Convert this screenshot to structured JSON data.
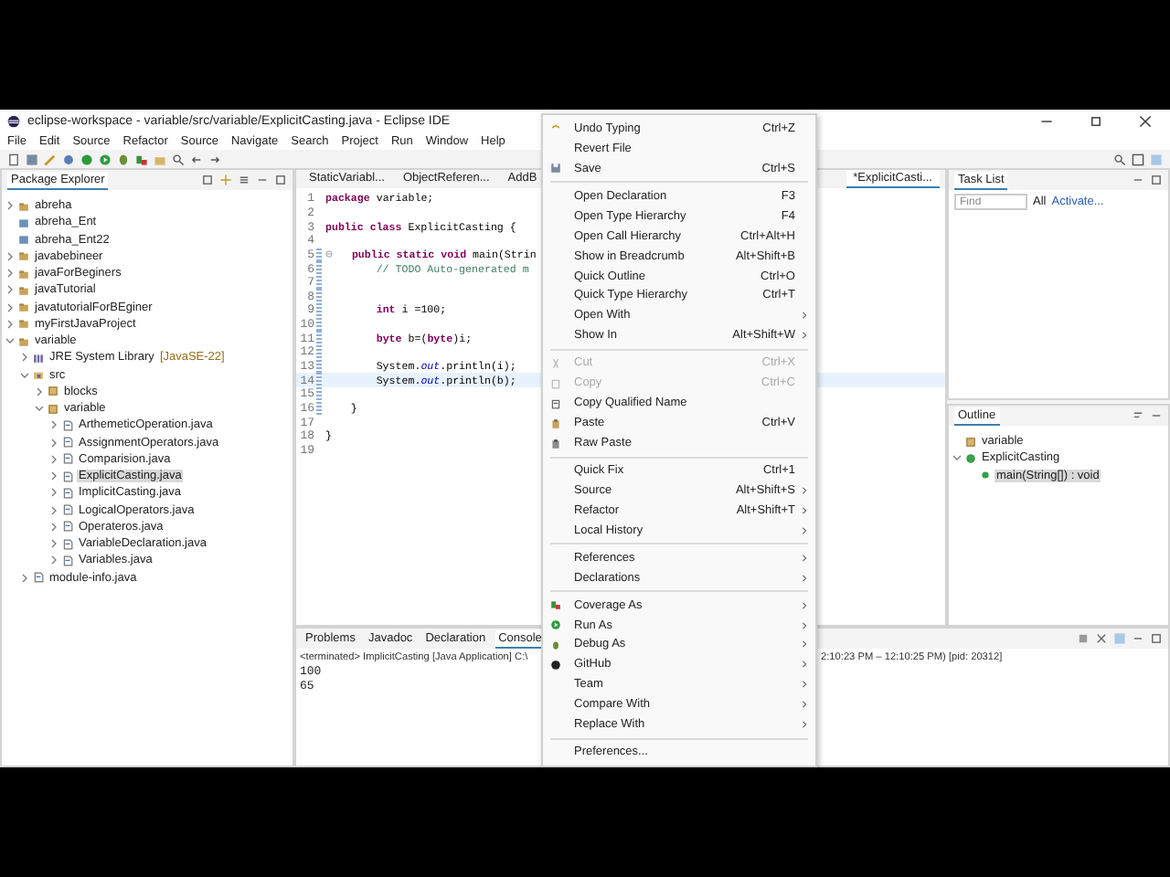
{
  "window": {
    "title": "eclipse-workspace - variable/src/variable/ExplicitCasting.java - Eclipse IDE"
  },
  "menu_bar": [
    "File",
    "Edit",
    "Source",
    "Refactor",
    "Source",
    "Navigate",
    "Search",
    "Project",
    "Run",
    "Window",
    "Help"
  ],
  "package_explorer": {
    "title": "Package Explorer",
    "tree": [
      {
        "label": "abreha",
        "kind": "project",
        "expanded": false,
        "selected": false
      },
      {
        "label": "abreha_Ent",
        "kind": "closed-project",
        "selected": false
      },
      {
        "label": "abreha_Ent22",
        "kind": "closed-project",
        "selected": false
      },
      {
        "label": "javabebineer",
        "kind": "project",
        "expanded": false,
        "selected": false
      },
      {
        "label": "javaForBeginers",
        "kind": "project",
        "expanded": false,
        "selected": false
      },
      {
        "label": "javaTutorial",
        "kind": "project",
        "expanded": false,
        "selected": false
      },
      {
        "label": "javatutorialForBEginer",
        "kind": "project",
        "expanded": false,
        "selected": false
      },
      {
        "label": "myFirstJavaProject",
        "kind": "project",
        "expanded": false,
        "selected": false
      },
      {
        "label": "variable",
        "kind": "project",
        "expanded": true,
        "selected": false,
        "children": [
          {
            "label": "JRE System Library",
            "decoration": "[JavaSE-22]",
            "kind": "library",
            "expanded": false,
            "selected": false
          },
          {
            "label": "src",
            "kind": "folder",
            "expanded": true,
            "selected": false,
            "children": [
              {
                "label": "blocks",
                "kind": "package",
                "expanded": false,
                "selected": false
              },
              {
                "label": "variable",
                "kind": "package",
                "expanded": true,
                "selected": false,
                "children": [
                  {
                    "label": "ArthemeticOperation.java",
                    "kind": "file",
                    "expanded": false,
                    "selected": false
                  },
                  {
                    "label": "AssignmentOperators.java",
                    "kind": "file",
                    "expanded": false,
                    "selected": false
                  },
                  {
                    "label": "Comparision.java",
                    "kind": "file",
                    "expanded": false,
                    "selected": false
                  },
                  {
                    "label": "ExplicitCasting.java",
                    "kind": "file",
                    "expanded": false,
                    "selected": true
                  },
                  {
                    "label": "ImplicitCasting.java",
                    "kind": "file",
                    "expanded": false,
                    "selected": false
                  },
                  {
                    "label": "LogicalOperators.java",
                    "kind": "file",
                    "expanded": false,
                    "selected": false
                  },
                  {
                    "label": "Operateros.java",
                    "kind": "file",
                    "expanded": false,
                    "selected": false
                  },
                  {
                    "label": "VariableDeclaration.java",
                    "kind": "file",
                    "expanded": false,
                    "selected": false
                  },
                  {
                    "label": "Variables.java",
                    "kind": "file",
                    "expanded": false,
                    "selected": false
                  }
                ]
              }
            ]
          },
          {
            "label": "module-info.java",
            "kind": "file",
            "expanded": false,
            "selected": false
          }
        ]
      }
    ]
  },
  "editor": {
    "tabs": [
      {
        "label": "StaticVariabl...",
        "selected": false
      },
      {
        "label": "ObjectReferen...",
        "selected": false
      },
      {
        "label": "AddB",
        "selected": false
      },
      {
        "label": "*ExplicitCasti...",
        "selected": true
      }
    ],
    "lines": [
      {
        "number": "1",
        "code": "**package** variable;",
        "kind": "code",
        "current": false
      },
      {
        "number": "2",
        "current": false
      },
      {
        "number": "3",
        "code": "**public class** ExplicitCasting {",
        "kind": "code",
        "current": false
      },
      {
        "number": "4",
        "current": false
      },
      {
        "number": "5",
        "code": "   **public static void** main(Strin",
        "kind": "code",
        "current": false,
        "folded": false
      },
      {
        "number": "6",
        "code": "        // TODO Auto-generated m",
        "kind": "comment",
        "current": false
      },
      {
        "number": "7",
        "current": false
      },
      {
        "number": "8",
        "current": false
      },
      {
        "number": "9",
        "code": "        **int** i =100;",
        "kind": "code",
        "current": false
      },
      {
        "number": "10",
        "current": false
      },
      {
        "number": "11",
        "code": "        **byte** b=(**byte**)i;",
        "kind": "code",
        "current": false
      },
      {
        "number": "12",
        "current": false
      },
      {
        "number": "13",
        "code": "        System.*out*.println(i);",
        "kind": "code",
        "current": false
      },
      {
        "number": "14",
        "code": "        System.*out*.println(b);",
        "kind": "code",
        "current": true
      },
      {
        "number": "15",
        "current": false
      },
      {
        "number": "16",
        "code": "    }",
        "kind": "code",
        "current": false
      },
      {
        "number": "17",
        "current": false
      },
      {
        "number": "18",
        "code": "}",
        "kind": "code",
        "current": false
      },
      {
        "number": "19",
        "current": false
      }
    ]
  },
  "task_list": {
    "title": "Task List",
    "find": {
      "placeholder": "Find"
    },
    "filters": [
      "All",
      "Activate..."
    ]
  },
  "outline": {
    "title": "Outline",
    "tree": [
      {
        "label": "variable",
        "kind": "package",
        "selected": false
      },
      {
        "label": "ExplicitCasting",
        "kind": "class",
        "expanded": true,
        "selected": false,
        "children": [
          {
            "label": "main(String[]) : void",
            "kind": "method",
            "selected": true
          }
        ]
      }
    ]
  },
  "console": {
    "tabs": [
      {
        "label": "Problems",
        "selected": false
      },
      {
        "label": "Javadoc",
        "selected": false
      },
      {
        "label": "Declaration",
        "selected": false
      },
      {
        "label": "Console",
        "selected": true
      }
    ],
    "status_left": "<terminated> ImplicitCasting [Java Application] C:\\",
    "status_right": "2:10:23 PM – 12:10:25 PM) [pid: 20312]",
    "output": [
      "100",
      "65"
    ]
  },
  "context_menu": {
    "items": [
      {
        "kind": "item",
        "label": "Undo Typing",
        "shortcut": "Ctrl+Z",
        "submenu": false,
        "disabled": false
      },
      {
        "kind": "item",
        "label": "Revert File",
        "submenu": false,
        "disabled": false
      },
      {
        "kind": "item",
        "label": "Save",
        "shortcut": "Ctrl+S",
        "submenu": false,
        "disabled": false
      },
      {
        "kind": "separator"
      },
      {
        "kind": "item",
        "label": "Open Declaration",
        "shortcut": "F3",
        "submenu": false,
        "disabled": false
      },
      {
        "kind": "item",
        "label": "Open Type Hierarchy",
        "shortcut": "F4",
        "submenu": false,
        "disabled": false
      },
      {
        "kind": "item",
        "label": "Open Call Hierarchy",
        "shortcut": "Ctrl+Alt+H",
        "submenu": false,
        "disabled": false
      },
      {
        "kind": "item",
        "label": "Show in Breadcrumb",
        "shortcut": "Alt+Shift+B",
        "submenu": false,
        "disabled": false
      },
      {
        "kind": "item",
        "label": "Quick Outline",
        "shortcut": "Ctrl+O",
        "submenu": false,
        "disabled": false
      },
      {
        "kind": "item",
        "label": "Quick Type Hierarchy",
        "shortcut": "Ctrl+T",
        "submenu": false,
        "disabled": false
      },
      {
        "kind": "item",
        "label": "Open With",
        "submenu": true,
        "disabled": false
      },
      {
        "kind": "item",
        "label": "Show In",
        "shortcut": "Alt+Shift+W",
        "submenu": true,
        "disabled": false
      },
      {
        "kind": "separator"
      },
      {
        "kind": "item",
        "label": "Cut",
        "shortcut": "Ctrl+X",
        "submenu": false,
        "disabled": true
      },
      {
        "kind": "item",
        "label": "Copy",
        "shortcut": "Ctrl+C",
        "submenu": false,
        "disabled": true
      },
      {
        "kind": "item",
        "label": "Copy Qualified Name",
        "submenu": false,
        "disabled": false
      },
      {
        "kind": "item",
        "label": "Paste",
        "shortcut": "Ctrl+V",
        "submenu": false,
        "disabled": false
      },
      {
        "kind": "item",
        "label": "Raw Paste",
        "submenu": false,
        "disabled": false
      },
      {
        "kind": "separator"
      },
      {
        "kind": "item",
        "label": "Quick Fix",
        "shortcut": "Ctrl+1",
        "submenu": false,
        "disabled": false
      },
      {
        "kind": "item",
        "label": "Source",
        "shortcut": "Alt+Shift+S",
        "submenu": true,
        "disabled": false
      },
      {
        "kind": "item",
        "label": "Refactor",
        "shortcut": "Alt+Shift+T",
        "submenu": true,
        "disabled": false
      },
      {
        "kind": "item",
        "label": "Local History",
        "submenu": true,
        "disabled": false
      },
      {
        "kind": "separator"
      },
      {
        "kind": "item",
        "label": "References",
        "submenu": true,
        "disabled": false
      },
      {
        "kind": "item",
        "label": "Declarations",
        "submenu": true,
        "disabled": false
      },
      {
        "kind": "separator"
      },
      {
        "kind": "item",
        "label": "Coverage As",
        "submenu": true,
        "disabled": false
      },
      {
        "kind": "item",
        "label": "Run As",
        "submenu": true,
        "disabled": false
      },
      {
        "kind": "item",
        "label": "Debug As",
        "submenu": true,
        "disabled": false
      },
      {
        "kind": "item",
        "label": "GitHub",
        "submenu": true,
        "disabled": false
      },
      {
        "kind": "item",
        "label": "Team",
        "submenu": true,
        "disabled": false
      },
      {
        "kind": "item",
        "label": "Compare With",
        "submenu": true,
        "disabled": false
      },
      {
        "kind": "item",
        "label": "Replace With",
        "submenu": true,
        "disabled": false
      },
      {
        "kind": "separator"
      },
      {
        "kind": "item",
        "label": "Preferences...",
        "submenu": false,
        "disabled": false
      }
    ]
  }
}
